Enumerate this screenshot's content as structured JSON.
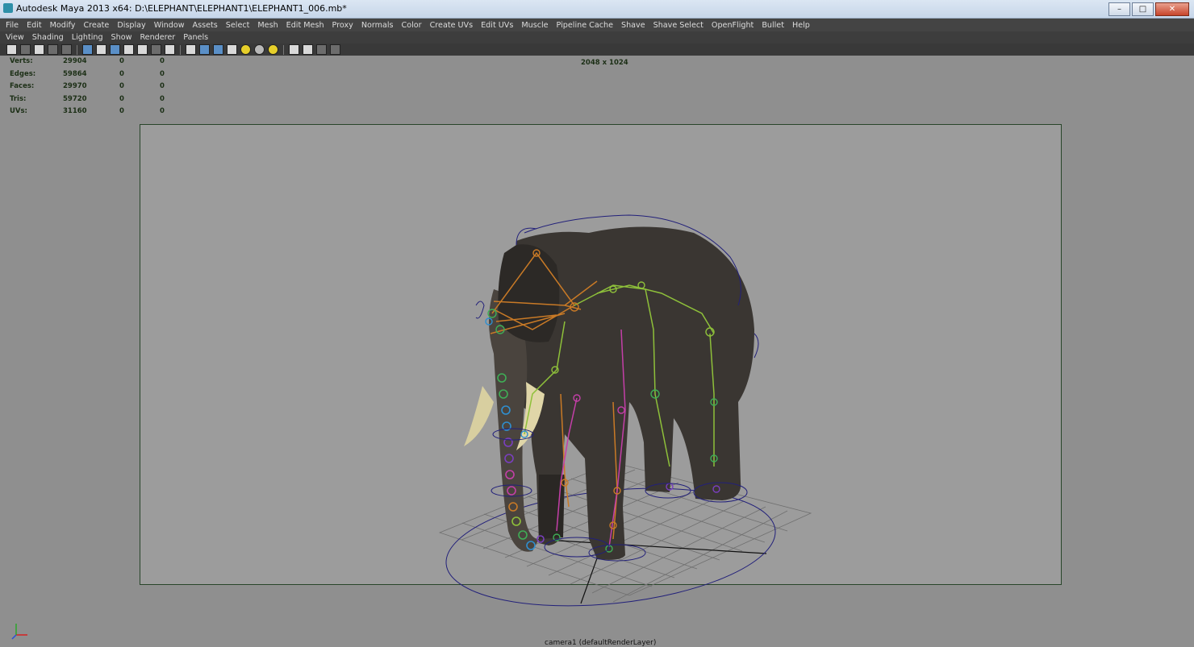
{
  "window": {
    "title": "Autodesk Maya 2013 x64: D:\\ELEPHANT\\ELEPHANT1\\ELEPHANT1_006.mb*"
  },
  "menubar": [
    "File",
    "Edit",
    "Modify",
    "Create",
    "Display",
    "Window",
    "Assets",
    "Select",
    "Mesh",
    "Edit Mesh",
    "Proxy",
    "Normals",
    "Color",
    "Create UVs",
    "Edit UVs",
    "Muscle",
    "Pipeline Cache",
    "Shave",
    "Shave Select",
    "OpenFlight",
    "Bullet",
    "Help"
  ],
  "panel_menu": [
    "View",
    "Shading",
    "Lighting",
    "Show",
    "Renderer",
    "Panels"
  ],
  "hud": {
    "stats": [
      {
        "label": "Verts:",
        "v1": "29904",
        "v2": "0",
        "v3": "0"
      },
      {
        "label": "Edges:",
        "v1": "59864",
        "v2": "0",
        "v3": "0"
      },
      {
        "label": "Faces:",
        "v1": "29970",
        "v2": "0",
        "v3": "0"
      },
      {
        "label": "Tris:",
        "v1": "59720",
        "v2": "0",
        "v3": "0"
      },
      {
        "label": "UVs:",
        "v1": "31160",
        "v2": "0",
        "v3": "0"
      }
    ],
    "resolution": "2048 x 1024"
  },
  "camera_label": "camera1 (defaultRenderLayer)",
  "colors": {
    "viewport_bg": "#8f8f8f",
    "gate_border": "#28452a",
    "menubar_bg": "#444444",
    "hud_text": "#1c2f16"
  }
}
